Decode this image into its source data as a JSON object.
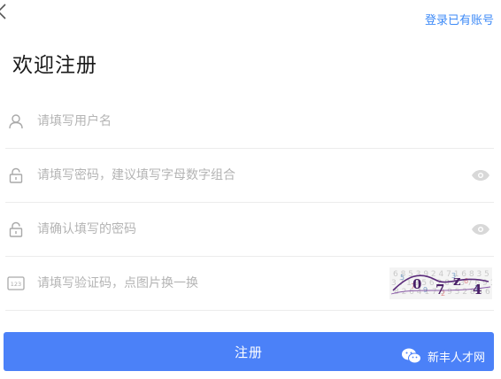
{
  "header": {
    "login_link": "登录已有账号"
  },
  "title": "欢迎注册",
  "fields": {
    "username": {
      "placeholder": "请填写用户名",
      "icon": "user-icon"
    },
    "password": {
      "placeholder": "请填写密码，建议填写字母数字组合",
      "icon": "lock-icon"
    },
    "confirm_password": {
      "placeholder": "请确认填写的密码",
      "icon": "lock-icon"
    },
    "captcha": {
      "placeholder": "请填写验证码，点图片换一换",
      "icon": "captcha-123-icon"
    }
  },
  "submit_label": "注册",
  "watermark": {
    "text": "新丰人才网",
    "icon": "wechat-icon"
  },
  "colors": {
    "accent": "#4b81f8",
    "link": "#3d8af7",
    "placeholder": "#b4b4b4",
    "divider": "#ececec"
  }
}
